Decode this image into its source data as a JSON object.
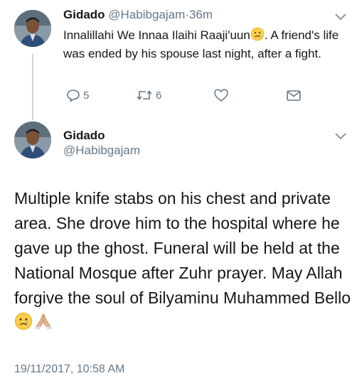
{
  "tweet1": {
    "display_name": "Gidado",
    "handle": "@Habibgajam",
    "separator": "·",
    "time_ago": "36m",
    "text_before_emoji": "Innalillahi We Innaa Ilaihi Raaji'uun",
    "text_after_emoji": ". A friend's life was ended by his spouse last night, after a fight.",
    "actions": {
      "reply_count": "5",
      "retweet_count": "6",
      "like_count": "",
      "icons": [
        "reply-icon",
        "retweet-icon",
        "heart-icon",
        "message-icon"
      ]
    }
  },
  "tweet2": {
    "display_name": "Gidado",
    "handle": "@Habibgajam",
    "text": "Multiple knife stabs on his chest and private area. She drove him to the hospital where he gave up the ghost. Funeral will be held at the National Mosque after Zuhr prayer. May Allah forgive the soul of Bilyaminu Muhammed Bello",
    "trailing_icons": [
      "sad-face-emoji",
      "praying-hands-emoji"
    ],
    "timestamp": "19/11/2017, 10:58 AM"
  },
  "colors": {
    "text": "#14171a",
    "muted": "#657786",
    "thread_line": "#ccd6dd",
    "background": "#ffffff"
  }
}
